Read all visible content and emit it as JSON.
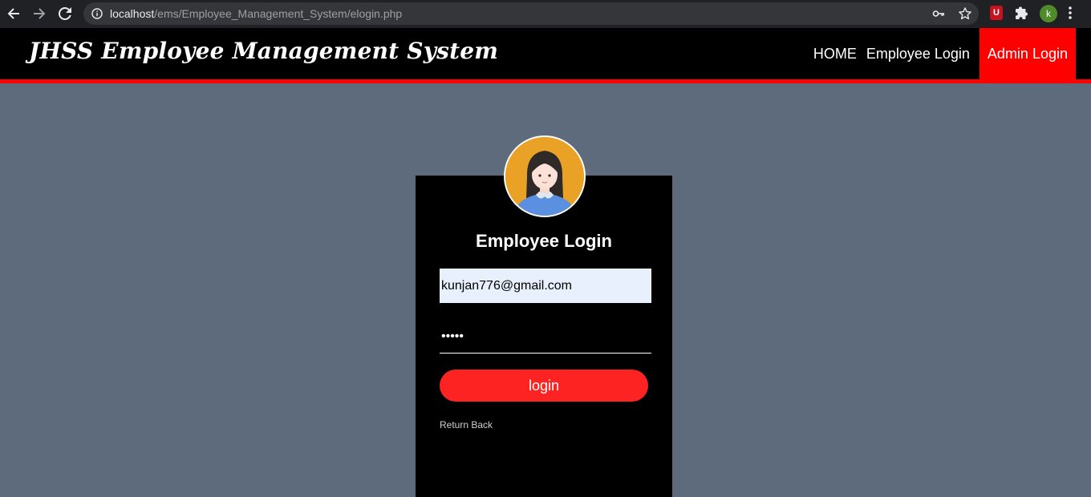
{
  "browser": {
    "url_host": "localhost",
    "url_path": "/ems/Employee_Management_System/elogin.php",
    "extension_badge": "U",
    "profile_initial": "k"
  },
  "site": {
    "brand": "JHSS Employee Management System",
    "nav": {
      "home": "HOME",
      "employee_login": "Employee Login",
      "admin_login": "Admin Login"
    },
    "colors": {
      "accent": "#ff0000",
      "header_bg": "#000000",
      "page_bg": "#5d6b7d"
    }
  },
  "login": {
    "title": "Employee Login",
    "email_value": "kunjan776@gmail.com",
    "password_value": "•••••",
    "button_label": "login",
    "return_label": "Return Back"
  }
}
